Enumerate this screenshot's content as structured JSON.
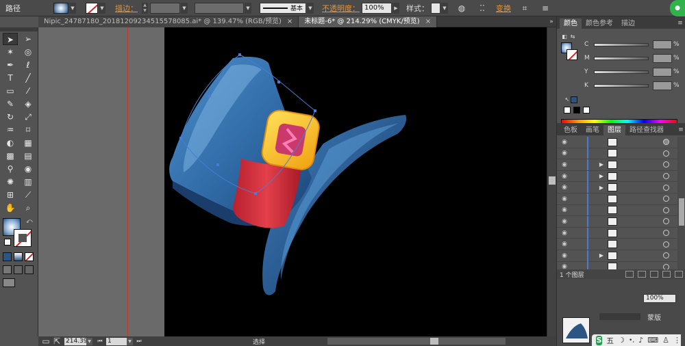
{
  "control_bar": {
    "title": "路径",
    "stroke_label": "描边：",
    "opacity_label": "不透明度：",
    "opacity_value": "100%",
    "style_label": "样式：",
    "stroke_profile": "基本",
    "transform_label": "变换"
  },
  "documents": {
    "tabs": [
      {
        "label": "Nipic_24787180_20181209234515578085.ai* @ 139.47% (RGB/预览)",
        "active": false
      },
      {
        "label": "未标题-6* @ 214.29% (CMYK/预览)",
        "active": true
      }
    ],
    "close_glyph": "×"
  },
  "color_panel": {
    "tabs": [
      "颜色",
      "颜色参考",
      "描边"
    ],
    "channels": [
      "C",
      "M",
      "Y",
      "K"
    ],
    "pct": "%"
  },
  "layers_panel": {
    "tabs": [
      "色板",
      "画笔",
      "图层",
      "路径查找器"
    ],
    "footer_label": "1 个图层",
    "row_count": 12,
    "expanded_rows": [
      2,
      3,
      4,
      10
    ]
  },
  "lower_panel": {
    "opacity_value": "100%",
    "button_label": "蒙版"
  },
  "status_bar": {
    "zoom": "214.39",
    "artboard": "1",
    "status": "选择"
  },
  "tray": {
    "ime_glyph": "S",
    "ime_mode": "五"
  },
  "colors": {
    "hat_blue": "#2c5583",
    "band_red": "#d0303c",
    "buckle_gold": "#f4b81c",
    "buckle_pink": "#d64a86",
    "guide_red": "#c0392b",
    "path_blue": "#4b7bd6"
  }
}
